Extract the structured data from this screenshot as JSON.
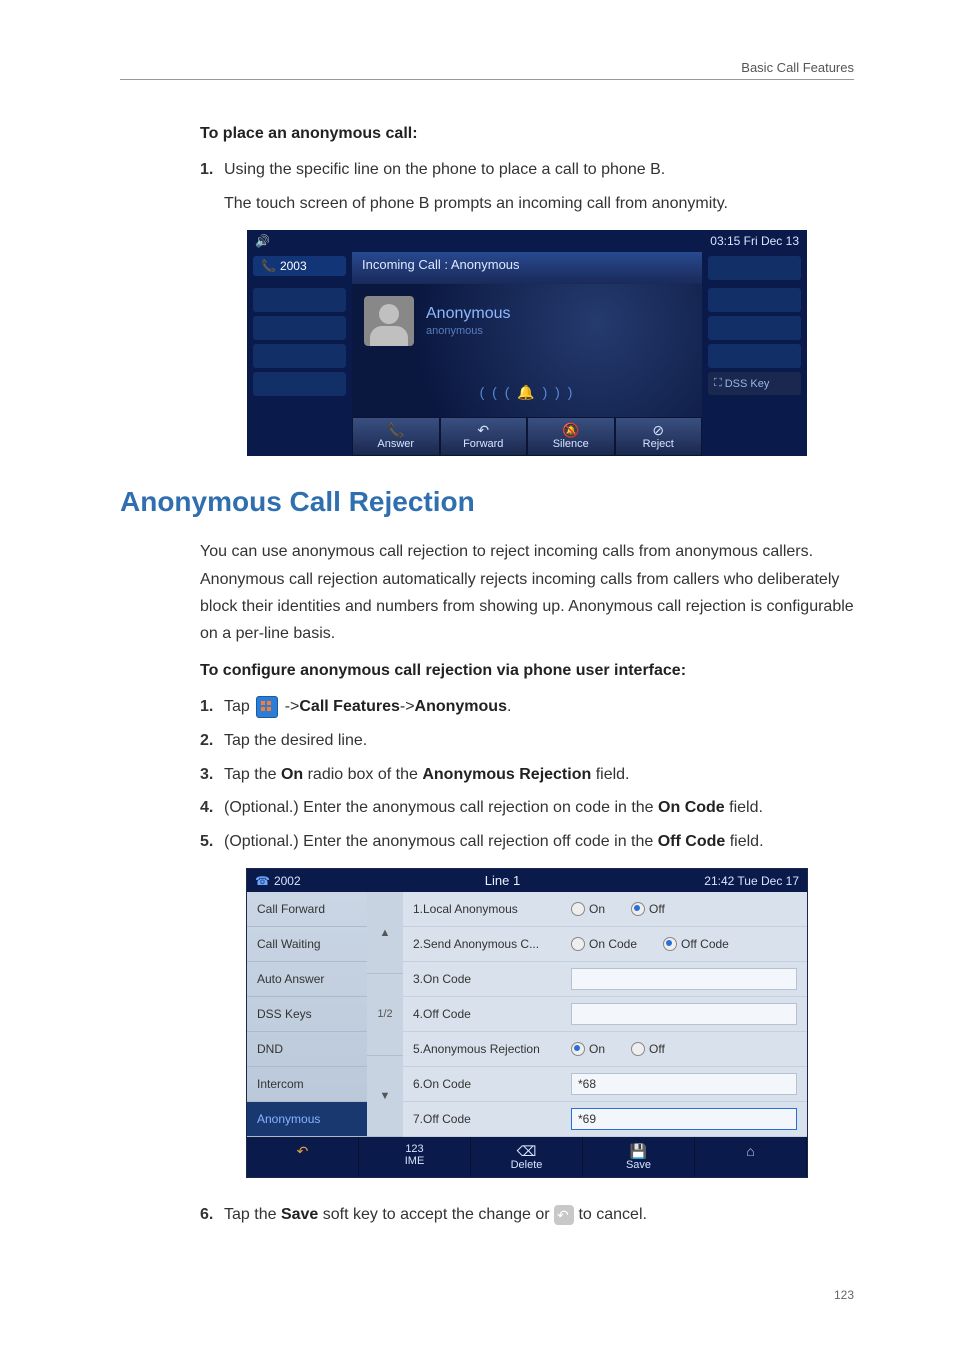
{
  "header": {
    "section": "Basic Call Features"
  },
  "intro": {
    "heading": "To place an anonymous call:",
    "step1_num": "1.",
    "step1_text": "Using the specific line on the phone to place a call to phone B.",
    "step1_sub": "The touch screen of phone B prompts an incoming call from anonymity."
  },
  "shot1": {
    "time": "03:15 Fri Dec 13",
    "line_label": "2003",
    "banner": "Incoming Call : Anonymous",
    "caller_name": "Anonymous",
    "caller_sub": "anonymous",
    "ring": "( ( ( 🔔 ) ) )",
    "dss": "DSS Key",
    "sk": {
      "answer": "Answer",
      "forward": "Forward",
      "silence": "Silence",
      "reject": "Reject"
    }
  },
  "section_title": "Anonymous Call Rejection",
  "para": "You can use anonymous call rejection to reject incoming calls from anonymous callers. Anonymous call rejection automatically rejects incoming calls from callers who deliberately block their identities and numbers from showing up. Anonymous call rejection is configurable on a per-line basis.",
  "config_heading": "To configure anonymous call rejection via phone user interface:",
  "steps": {
    "s1a": "Tap ",
    "s1b": " ->",
    "s1c": "Call Features",
    "s1d": "->",
    "s1e": "Anonymous",
    "s1f": ".",
    "s2": "Tap the desired line.",
    "s3a": "Tap the ",
    "s3b": "On",
    "s3c": " radio box of the ",
    "s3d": "Anonymous Rejection",
    "s3e": " field.",
    "s4a": "(Optional.) Enter the anonymous call rejection on code in the ",
    "s4b": "On Code",
    "s4c": " field.",
    "s5a": "(Optional.) Enter the anonymous call rejection off code in the ",
    "s5b": "Off Code",
    "s5c": " field.",
    "n1": "1.",
    "n2": "2.",
    "n3": "3.",
    "n4": "4.",
    "n5": "5.",
    "n6": "6."
  },
  "shot2": {
    "account": "2002",
    "title": "Line 1",
    "time": "21:42 Tue Dec 17",
    "sidebar": {
      "i1": "Call Forward",
      "i2": "Call Waiting",
      "i3": "Auto Answer",
      "i4": "DSS Keys",
      "i5": "DND",
      "i6": "Intercom",
      "i7": "Anonymous"
    },
    "pager": {
      "up": "▲",
      "mid": "1/2",
      "down": "▼"
    },
    "rows": {
      "r1": {
        "label": "1.Local Anonymous",
        "a": "On",
        "b": "Off"
      },
      "r2": {
        "label": "2.Send Anonymous C...",
        "a": "On Code",
        "b": "Off Code"
      },
      "r3": {
        "label": "3.On Code"
      },
      "r4": {
        "label": "4.Off Code"
      },
      "r5": {
        "label": "5.Anonymous Rejection",
        "a": "On",
        "b": "Off"
      },
      "r6": {
        "label": "6.On Code",
        "val": "*68"
      },
      "r7": {
        "label": "7.Off Code",
        "val": "*69"
      }
    },
    "bottom": {
      "back": "",
      "ime1": "123",
      "ime2": "IME",
      "del": "Delete",
      "save": "Save",
      "home": ""
    }
  },
  "step6": {
    "a": "Tap the ",
    "b": "Save",
    "c": " soft key to accept the change or ",
    "d": " to cancel."
  },
  "page_num": "123"
}
